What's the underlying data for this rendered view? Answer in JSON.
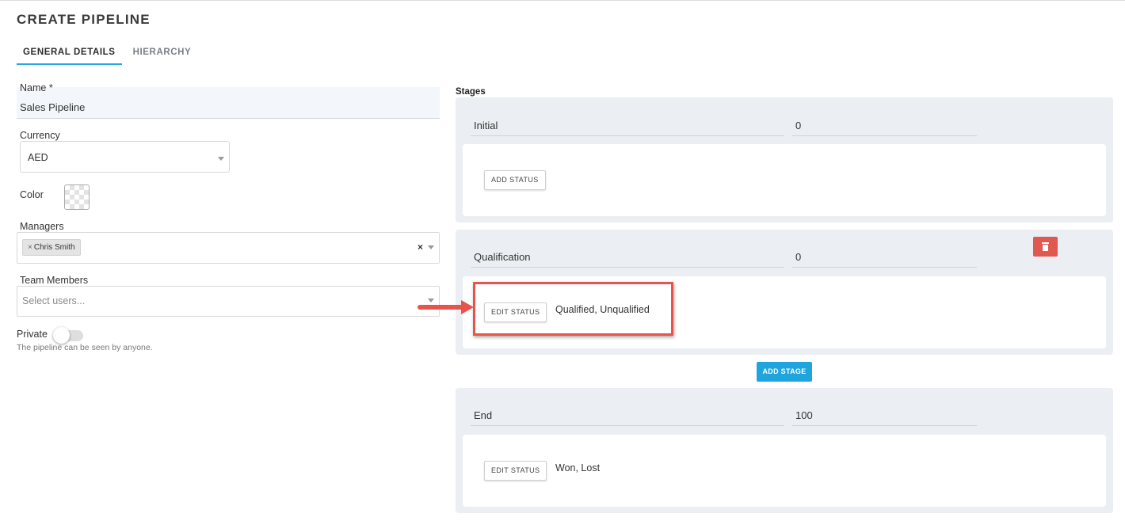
{
  "page": {
    "title": "CREATE PIPELINE"
  },
  "tabs": [
    {
      "label": "GENERAL DETAILS",
      "active": true
    },
    {
      "label": "HIERARCHY",
      "active": false
    }
  ],
  "form": {
    "name": {
      "label": "Name *",
      "value": "Sales Pipeline"
    },
    "currency": {
      "label": "Currency",
      "value": "AED"
    },
    "color": {
      "label": "Color"
    },
    "managers": {
      "label": "Managers",
      "chips": [
        "Chris Smith"
      ],
      "clear_symbol": "×"
    },
    "team_members": {
      "label": "Team Members",
      "placeholder": "Select users..."
    },
    "private": {
      "label": "Private",
      "enabled": false,
      "helper": "The pipeline can be seen by anyone."
    }
  },
  "stages": {
    "title": "Stages",
    "items": [
      {
        "name": "Initial",
        "probability": "0",
        "button": "ADD STATUS",
        "statuses": ""
      },
      {
        "name": "Qualification",
        "probability": "0",
        "button": "EDIT STATUS",
        "statuses": "Qualified, Unqualified",
        "deletable": true
      },
      {
        "name": "End",
        "probability": "100",
        "button": "EDIT STATUS",
        "statuses": "Won, Lost"
      }
    ],
    "add_stage_label": "ADD STAGE"
  },
  "colors": {
    "accent": "#1ea5dd",
    "danger": "#e0584f",
    "annotation": "#e8534a",
    "stage_bg": "#ebeef2"
  }
}
